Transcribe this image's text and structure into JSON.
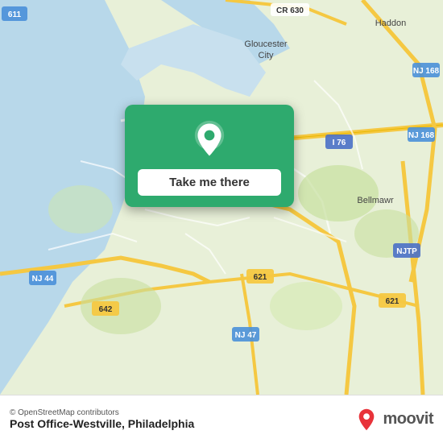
{
  "map": {
    "background_color": "#e8f0d8",
    "credit": "© OpenStreetMap contributors",
    "location_name": "Post Office-Westville, Philadelphia"
  },
  "popup": {
    "button_label": "Take me there",
    "background_color": "#2eaa6e"
  },
  "moovit": {
    "logo_text": "moovit"
  }
}
